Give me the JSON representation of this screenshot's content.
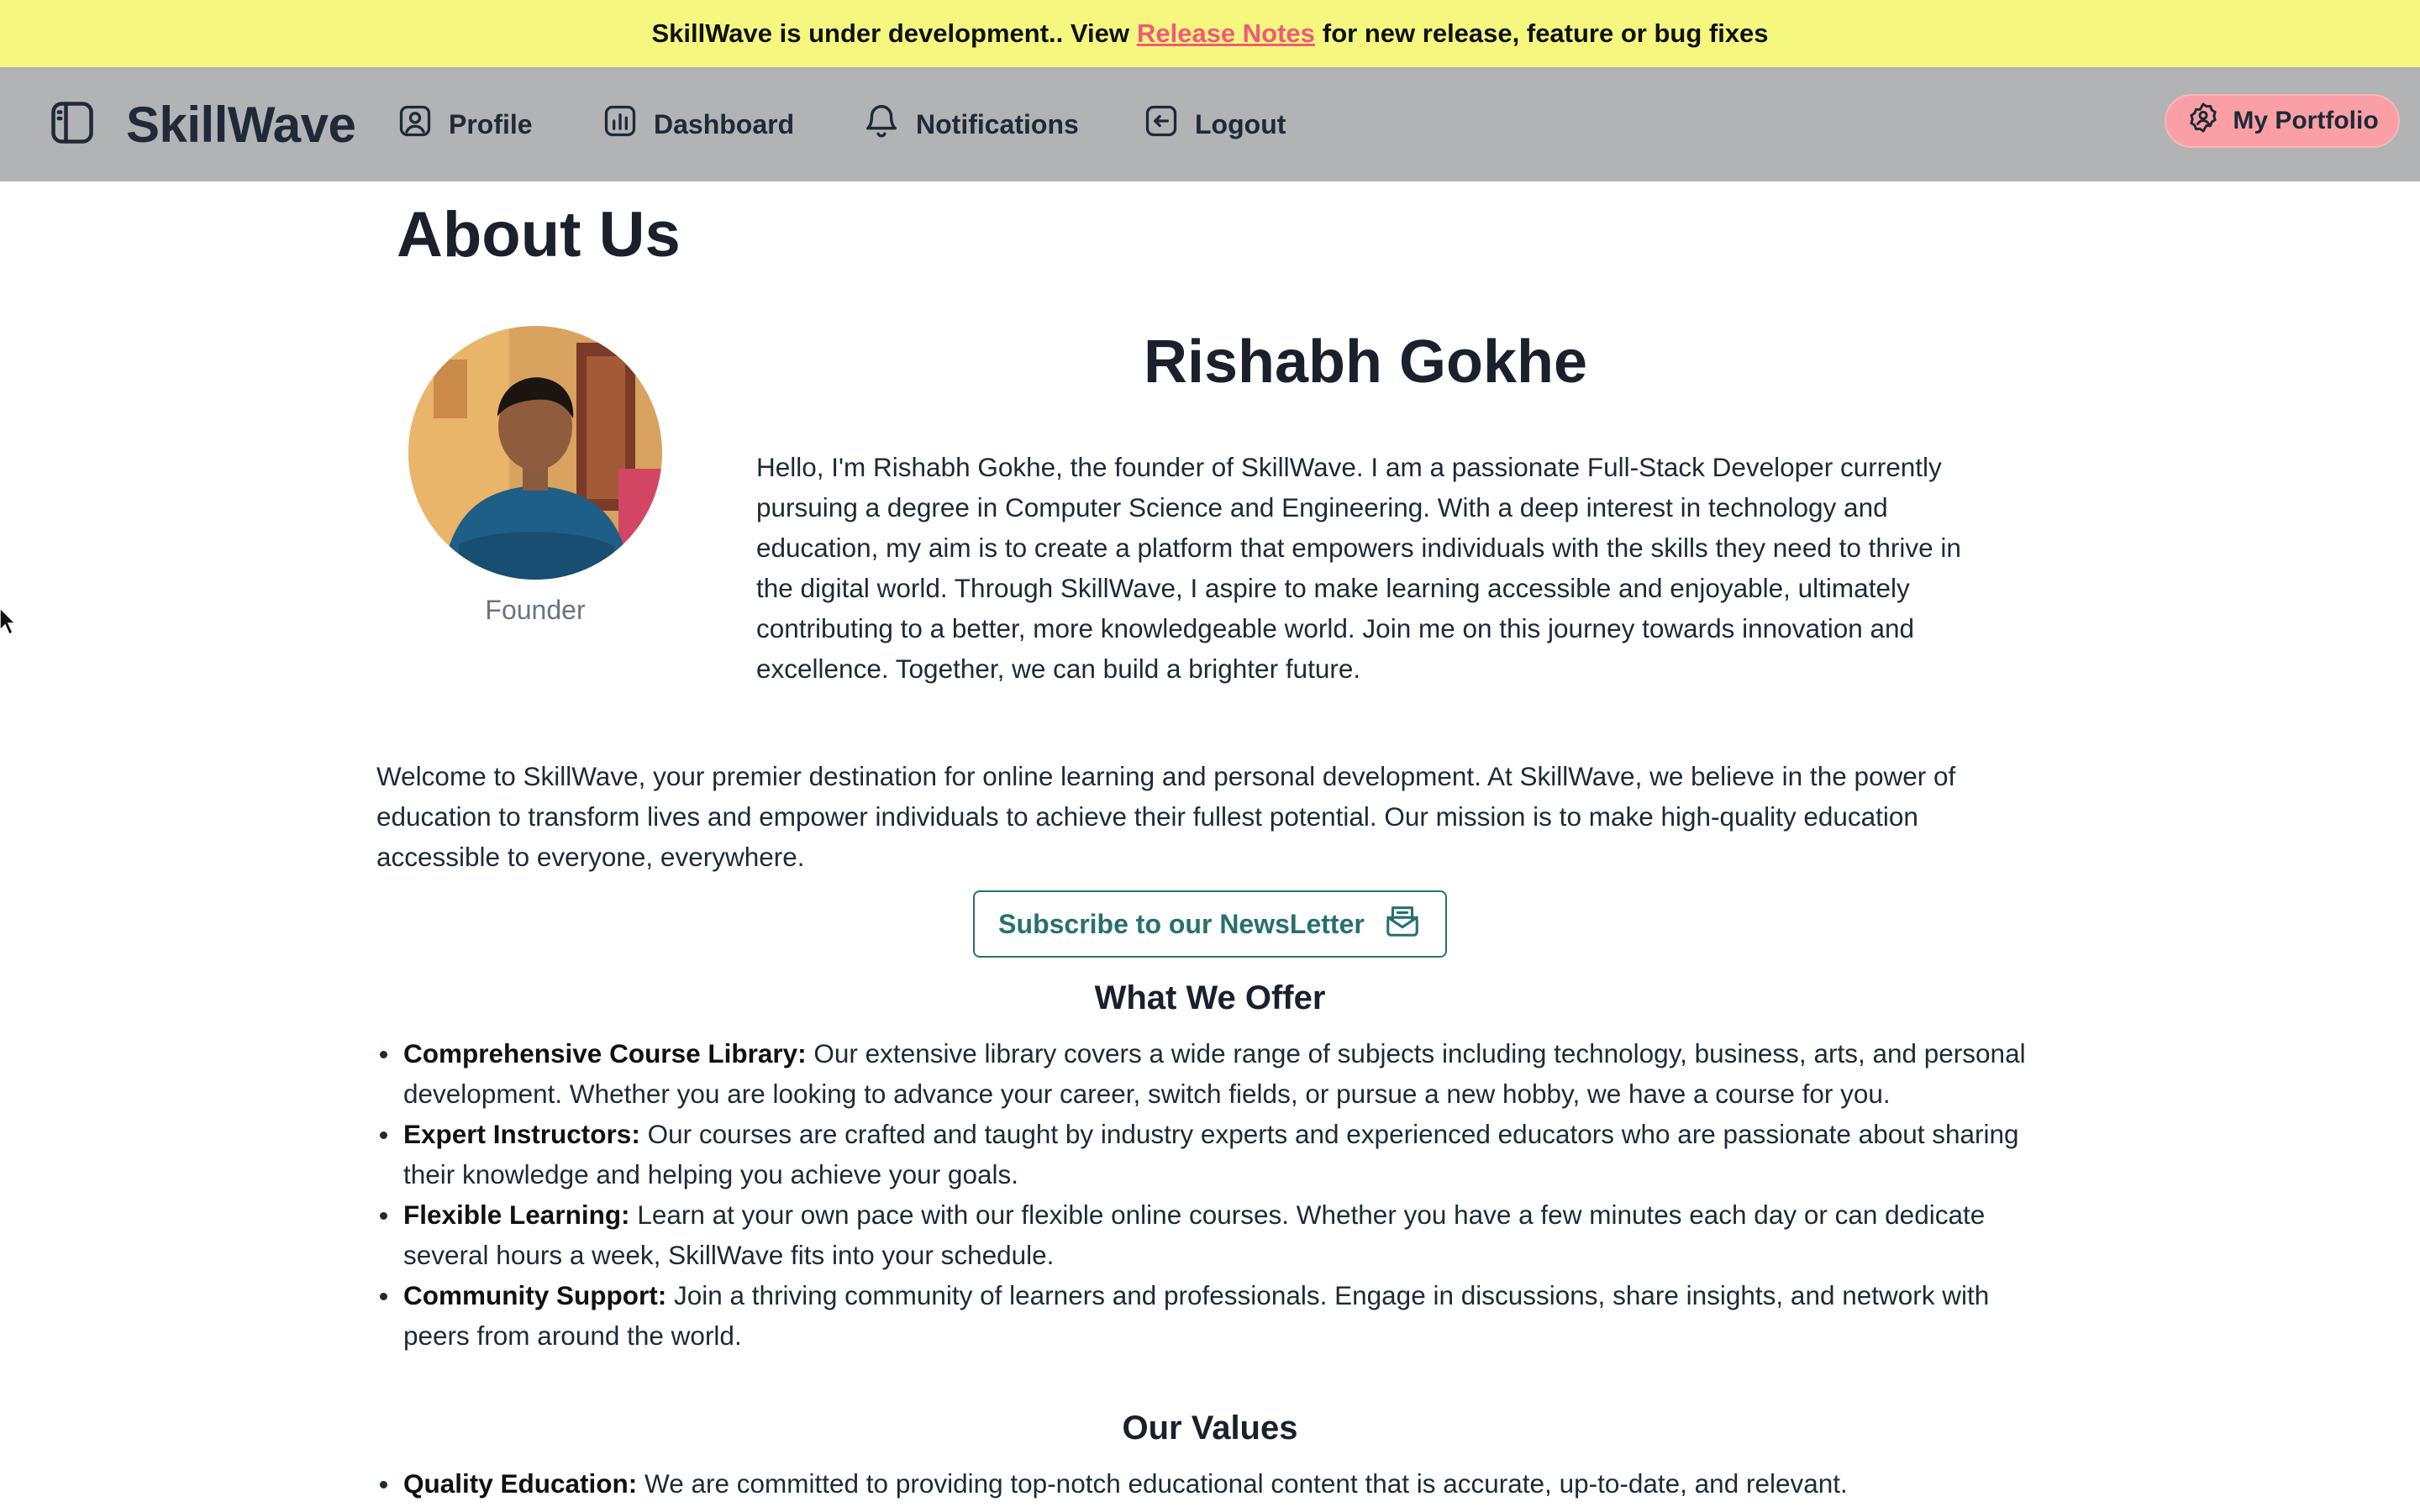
{
  "banner": {
    "text_before": "SkillWave is under development.. View",
    "link": "Release Notes",
    "text_after": "for new release, feature or bug fixes"
  },
  "navbar": {
    "brand": "SkillWave",
    "links": {
      "profile": "Profile",
      "dashboard": "Dashboard",
      "notifications": "Notifications",
      "logout": "Logout"
    },
    "portfolio_button": "My Portfolio"
  },
  "page": {
    "title": "About Us"
  },
  "founder": {
    "name": "Rishabh Gokhe",
    "role": "Founder",
    "bio": "Hello, I'm Rishabh Gokhe, the founder of SkillWave. I am a passionate Full-Stack Developer currently pursuing a degree in Computer Science and Engineering. With a deep interest in technology and education, my aim is to create a platform that empowers individuals with the skills they need to thrive in the digital world. Through SkillWave, I aspire to make learning accessible and enjoyable, ultimately contributing to a better, more knowledgeable world. Join me on this journey towards innovation and excellence. Together, we can build a brighter future."
  },
  "intro": "Welcome to SkillWave, your premier destination for online learning and personal development. At SkillWave, we believe in the power of education to transform lives and empower individuals to achieve their fullest potential. Our mission is to make high-quality education accessible to everyone, everywhere.",
  "subscribe_button": "Subscribe to our NewsLetter",
  "offer": {
    "heading": "What We Offer",
    "items": [
      {
        "title": "Comprehensive Course Library:",
        "text": "Our extensive library covers a wide range of subjects including technology, business, arts, and personal development. Whether you are looking to advance your career, switch fields, or pursue a new hobby, we have a course for you."
      },
      {
        "title": "Expert Instructors:",
        "text": "Our courses are crafted and taught by industry experts and experienced educators who are passionate about sharing their knowledge and helping you achieve your goals."
      },
      {
        "title": "Flexible Learning:",
        "text": "Learn at your own pace with our flexible online courses. Whether you have a few minutes each day or can dedicate several hours a week, SkillWave fits into your schedule."
      },
      {
        "title": "Community Support:",
        "text": "Join a thriving community of learners and professionals. Engage in discussions, share insights, and network with peers from around the world."
      }
    ]
  },
  "values": {
    "heading": "Our Values",
    "items": [
      {
        "title": "Quality Education:",
        "text": "We are committed to providing top-notch educational content that is accurate, up-to-date, and relevant."
      }
    ]
  }
}
